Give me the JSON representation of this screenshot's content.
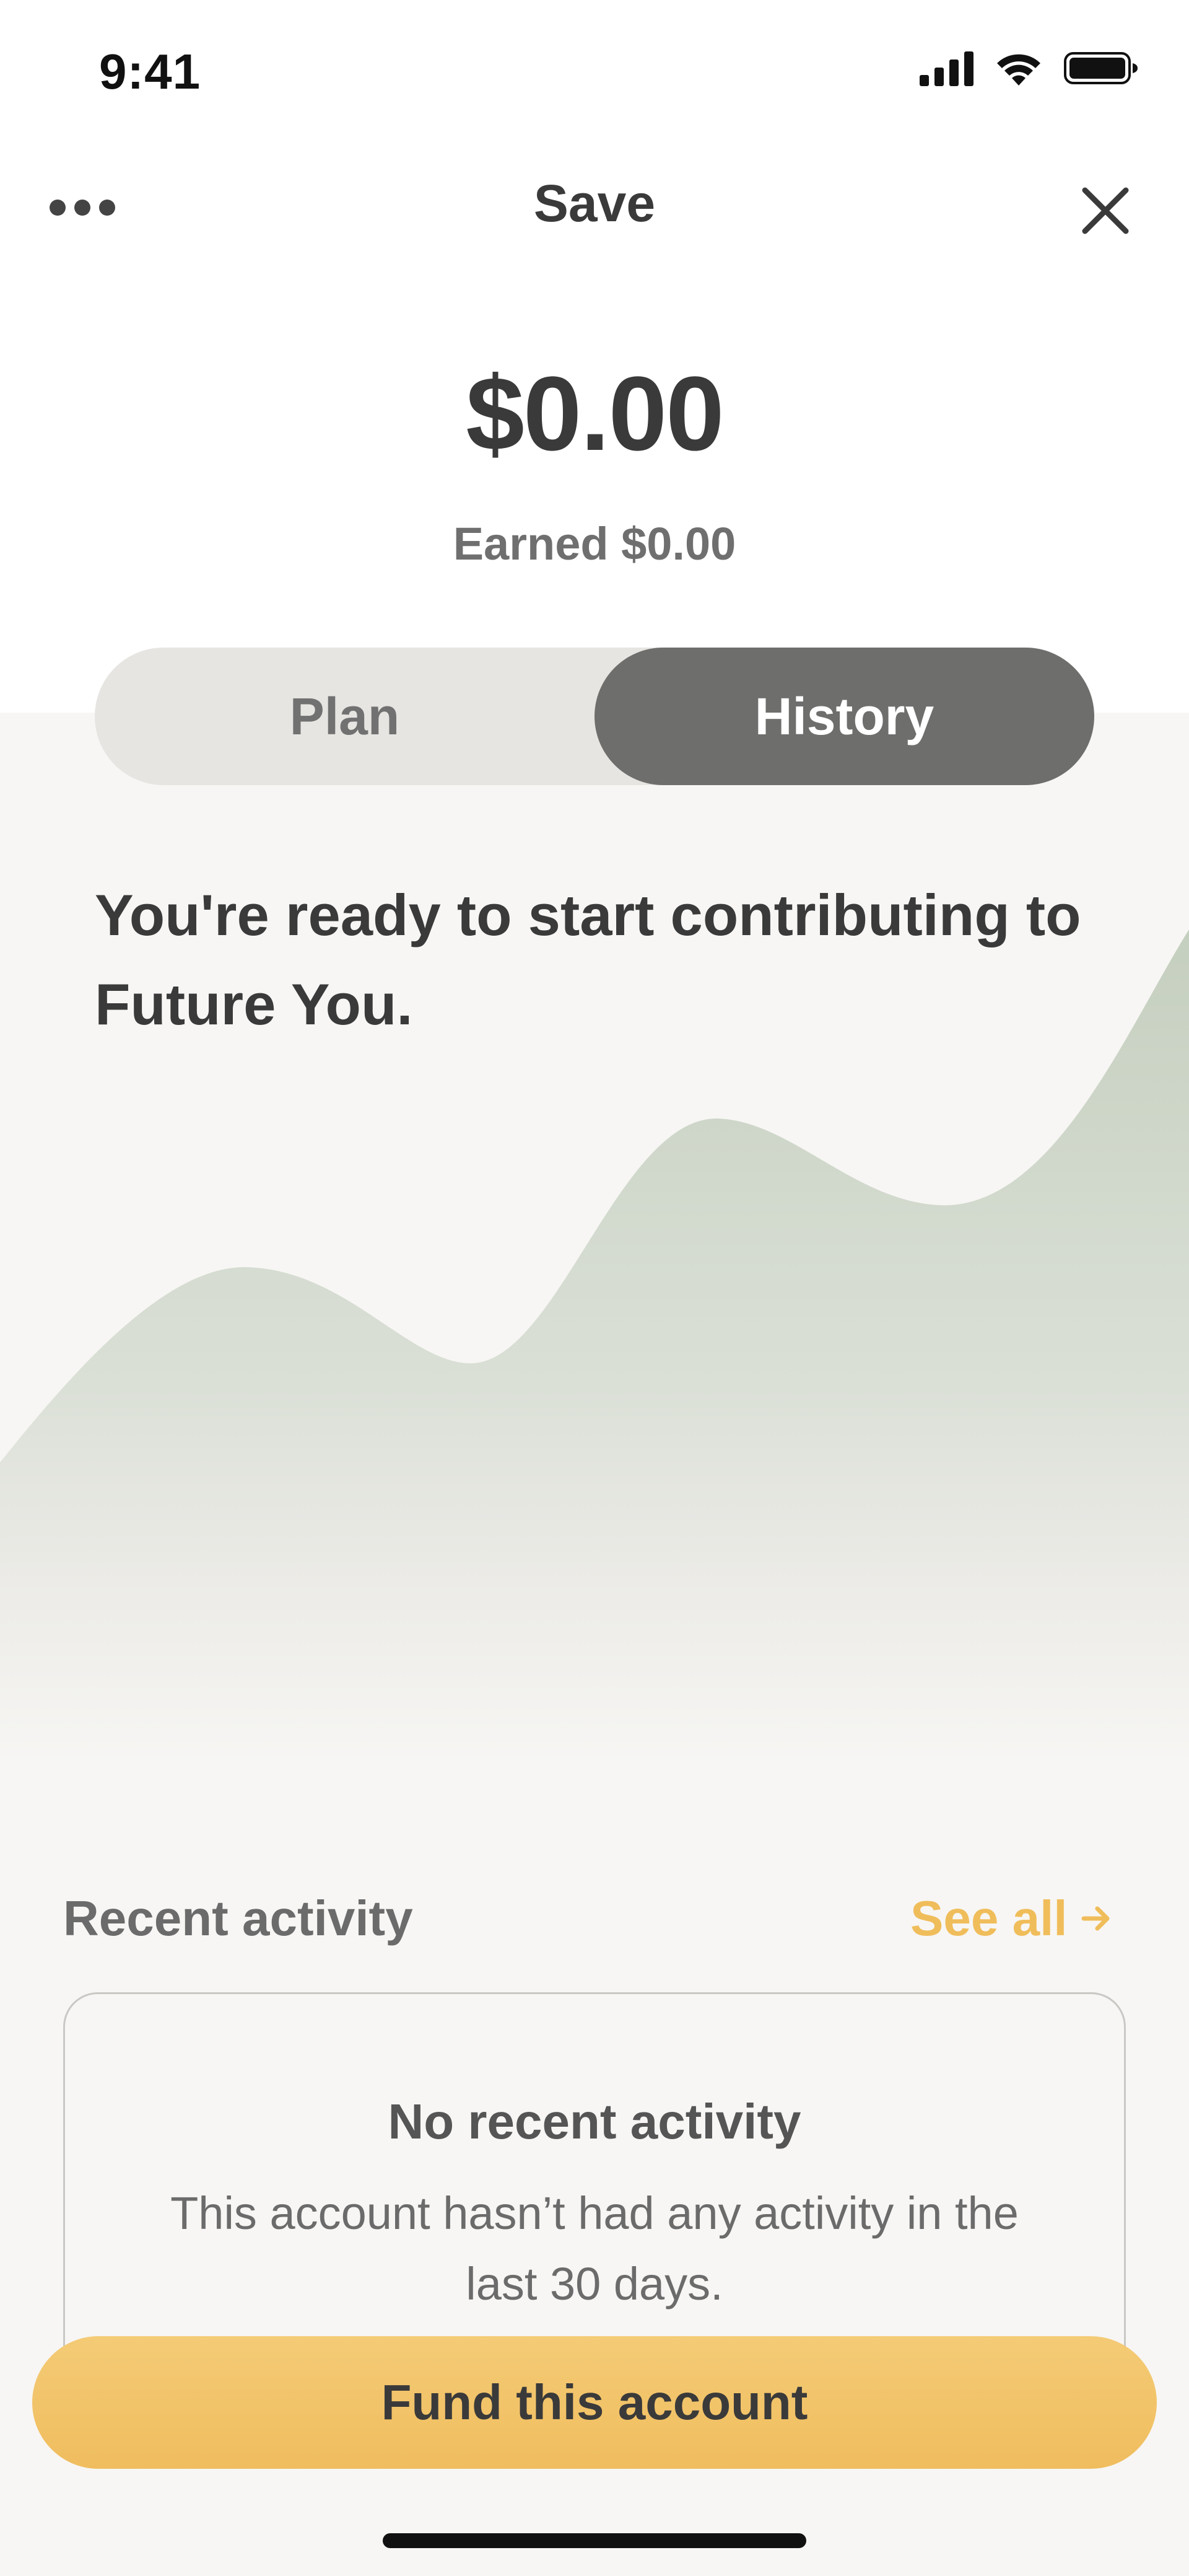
{
  "status_bar": {
    "time": "9:41"
  },
  "nav": {
    "title": "Save"
  },
  "account": {
    "balance": "$0.00",
    "earned": "Earned $0.00"
  },
  "tabs": [
    {
      "label": "Plan",
      "selected": false
    },
    {
      "label": "History",
      "selected": true
    }
  ],
  "headline": "You're ready to start contributing to Future You.",
  "recent_activity": {
    "title": "Recent activity",
    "see_all": "See all",
    "empty_title": "No recent activity",
    "empty_text": "This account hasn’t had any activity in the last 30 days."
  },
  "fund_button": "Fund this account",
  "colors": {
    "accent": "#f0bd5b",
    "toggle_selected": "#6e6e6c",
    "chart_fill": "#c5cfbf"
  }
}
